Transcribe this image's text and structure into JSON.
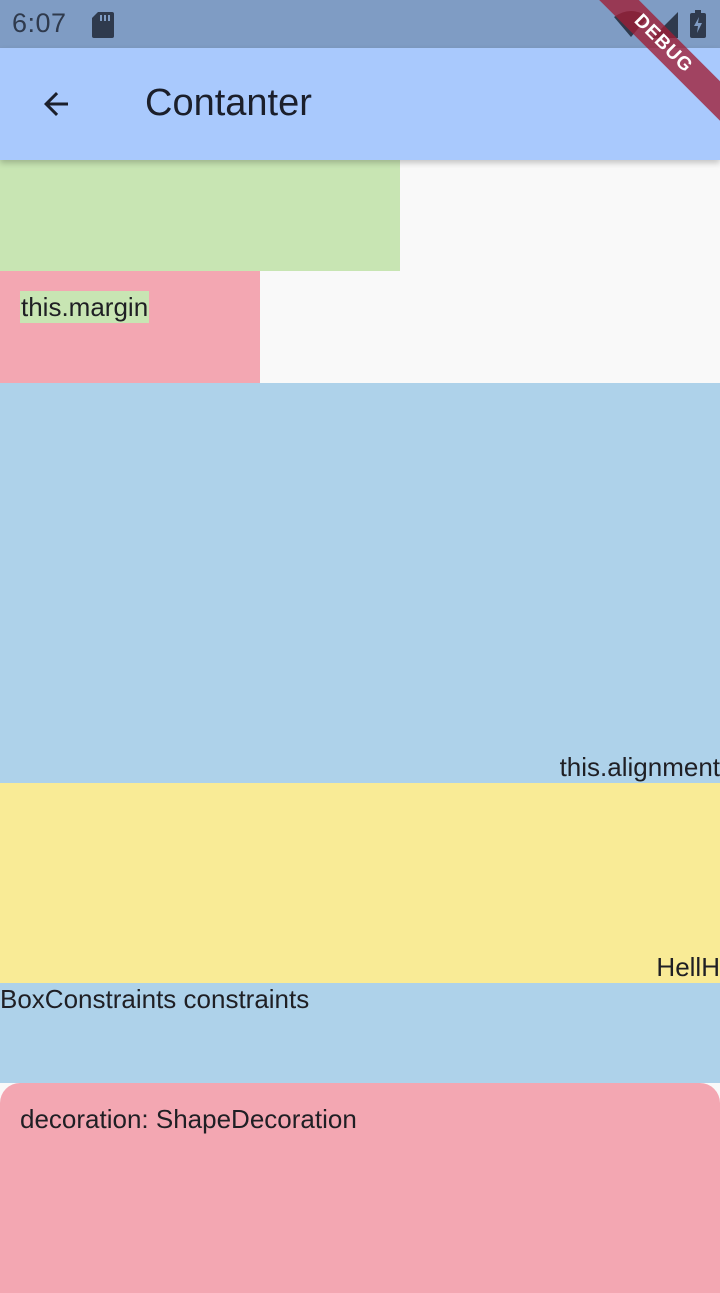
{
  "status_bar": {
    "time": "6:07",
    "icons": [
      "sd-card-icon",
      "wifi-icon",
      "signal-icon",
      "battery-icon"
    ]
  },
  "app_bar": {
    "back_icon": "arrow-back-icon",
    "title": "Contanter"
  },
  "debug_banner": {
    "label": "DEBUG",
    "color": "#9f1e35"
  },
  "boxes": {
    "green": {
      "color": "#c8e5b3"
    },
    "margin": {
      "label": "this.margin",
      "color": "#f3a7b2"
    },
    "alignment": {
      "label": "this.alignment",
      "color": "#aed2ea"
    },
    "yellow": {
      "label": "HellH",
      "color": "#f9eb96"
    },
    "constraints": {
      "label": "BoxConstraints constraints",
      "color": "#aed2ea"
    },
    "decoration": {
      "label": "decoration: ShapeDecoration",
      "color": "#f3a7b2"
    }
  },
  "colors": {
    "status_bar": "#7f9cc4",
    "app_bar": "#a9c9fd",
    "background": "#f9f9f9"
  }
}
